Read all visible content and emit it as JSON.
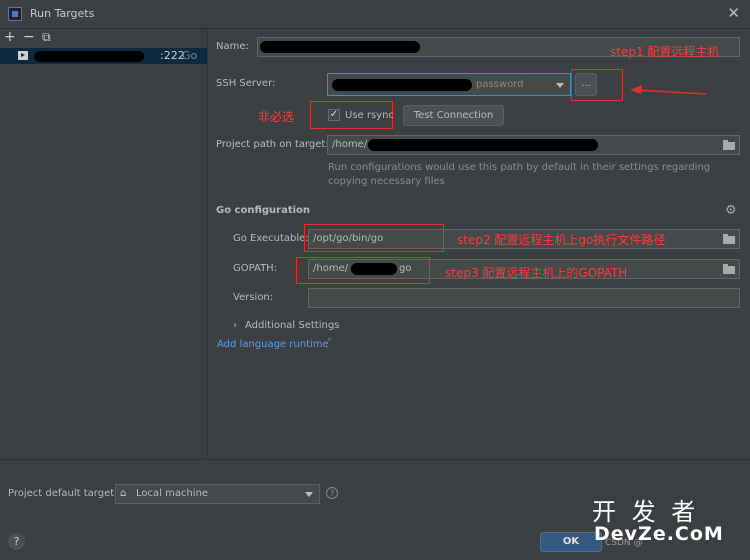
{
  "window": {
    "title": "Run Targets"
  },
  "toolbar": {
    "add": "+",
    "remove": "−",
    "copy": "⧉"
  },
  "target_list": {
    "item_suffix": ":222",
    "item_type": "Go"
  },
  "form": {
    "name_label": "Name:",
    "ssh_label": "SSH Server:",
    "ssh_value": "password",
    "ssh_more": "...",
    "use_rsync": "Use rsync",
    "test_connection": "Test Connection",
    "project_path_label": "Project path on target:",
    "project_path_value": "/home/",
    "project_path_hint": "Run configurations would use this path by default in their settings regarding copying necessary files"
  },
  "go_config": {
    "section_title": "Go configuration",
    "exec_label": "Go Executable:",
    "exec_value": "/opt/go/bin/go",
    "gopath_label": "GOPATH:",
    "gopath_value_prefix": "/home/",
    "gopath_value_suffix": "go",
    "version_label": "Version:",
    "additional_settings": "Additional Settings",
    "add_runtime": "Add language runtime"
  },
  "annotations": {
    "step1": "step1 配置远程主机",
    "optional": "非必选",
    "step2": "step2 配置远程主机上go执行文件路径",
    "step3": "step3 配置远程主机上的GOPATH"
  },
  "footer": {
    "default_target_label": "Project default target:",
    "default_target_value": "Local machine",
    "ok": "OK",
    "help": "?"
  },
  "watermark": {
    "line1": "开 发 者",
    "line2": "DevZe.CoM",
    "faint": "CSDN @"
  }
}
